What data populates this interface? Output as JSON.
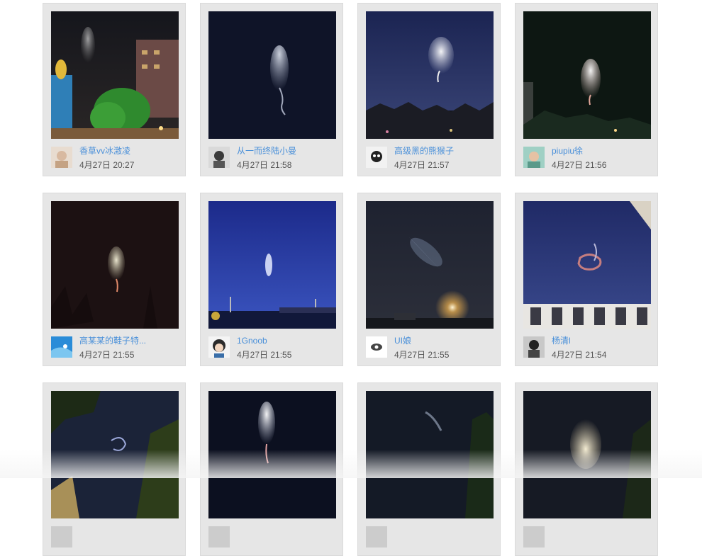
{
  "posts": [
    {
      "user": "香草vv冰激凌",
      "time": "4月27日 20:27"
    },
    {
      "user": "从一而终陆小曼",
      "time": "4月27日 21:58"
    },
    {
      "user": "高级黑的熊猴子",
      "time": "4月27日 21:57"
    },
    {
      "user": "piupiu徐",
      "time": "4月27日 21:56"
    },
    {
      "user": "高某某的鞋子特...",
      "time": "4月27日 21:55"
    },
    {
      "user": "1Gnoob",
      "time": "4月27日 21:55"
    },
    {
      "user": "UI娘",
      "time": "4月27日 21:55"
    },
    {
      "user": "杨清l",
      "time": "4月27日 21:54"
    },
    {
      "user": "",
      "time": ""
    },
    {
      "user": "",
      "time": ""
    },
    {
      "user": "",
      "time": ""
    },
    {
      "user": "",
      "time": ""
    }
  ]
}
